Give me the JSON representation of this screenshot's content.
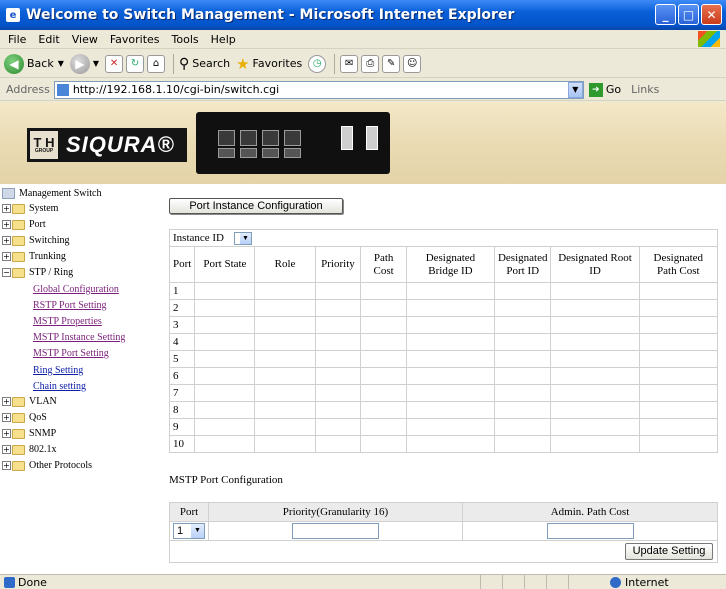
{
  "window": {
    "title": "Welcome to Switch Management - Microsoft Internet Explorer",
    "min": "_",
    "max": "□",
    "close": "✕"
  },
  "menu": [
    "File",
    "Edit",
    "View",
    "Favorites",
    "Tools",
    "Help"
  ],
  "toolbar": {
    "back": "Back",
    "search": "Search",
    "favorites": "Favorites"
  },
  "address": {
    "label": "Address",
    "url": "http://192.168.1.10/cgi-bin/switch.cgi",
    "go": "Go",
    "links": "Links"
  },
  "banner": {
    "logo_th": "T H",
    "logo_group": "GROUP",
    "brand": "SIQURA®"
  },
  "tree": {
    "root": "Management Switch",
    "items": [
      "System",
      "Port",
      "Switching",
      "Trunking",
      "STP / Ring",
      "VLAN",
      "QoS",
      "SNMP",
      "802.1x",
      "Other Protocols"
    ],
    "stp_children": [
      "Global Configuration",
      "RSTP Port Setting",
      "MSTP Properties",
      "MSTP Instance Setting",
      "MSTP Port Setting",
      "Ring Setting",
      "Chain setting"
    ]
  },
  "main": {
    "instance_button": "Port Instance Configuration",
    "instance_label": "Instance ID",
    "columns": [
      "Port",
      "Port State",
      "Role",
      "Priority",
      "Path Cost",
      "Designated Bridge ID",
      "Designated Port ID",
      "Designated Root ID",
      "Designated Path Cost"
    ],
    "rows": [
      "1",
      "2",
      "3",
      "4",
      "5",
      "6",
      "7",
      "8",
      "9",
      "10"
    ],
    "mstp_title": "MSTP Port Configuration",
    "mstp_headers": [
      "Port",
      "Priority(Granularity 16)",
      "Admin. Path Cost"
    ],
    "port_value": "1",
    "update_button": "Update Setting"
  },
  "status": {
    "text": "Done",
    "zone": "Internet"
  }
}
